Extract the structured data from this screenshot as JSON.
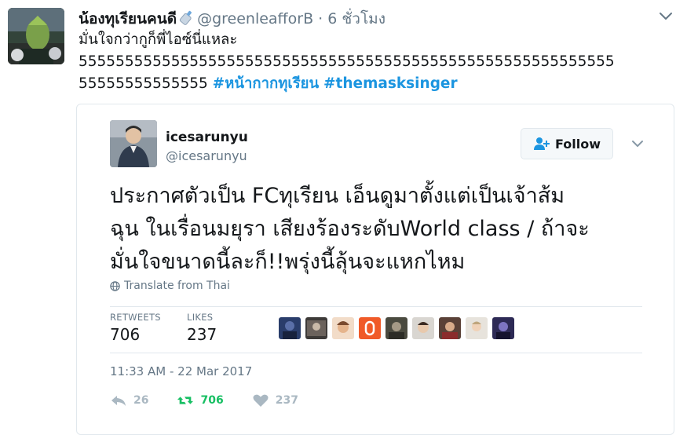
{
  "tweet": {
    "display_name": "น้องทุเรียนคนดี",
    "handle": "@greenleafforB",
    "separator": "·",
    "time": "6 ชั่วโมง",
    "text_line1": "มั่นใจกว่ากูก็พี่ไอซ์นี่แหละ",
    "text_line2": "5555555555555555555555555555555555555555555555555555555555",
    "text_line3_prefix": "55555555555555 ",
    "hashtag1": "#หน้ากากทุเรียน",
    "hashtag2": "#themasksinger"
  },
  "quoted": {
    "display_name": "icesarunyu",
    "handle": "@icesarunyu",
    "follow_label": "Follow",
    "text_lines": [
      "ประกาศตัวเป็น FCทุเรียน เอ็นดูมาตั้งแต่เป็นเจ้าส้ม",
      "ฉุน ในเรื่อนมยุรา เสียงร้องระดับWorld class / ถ้าจะ",
      "มั่นใจขนาดนี้ละก็!!พรุ่งนี้ลุ้นจะแหกไหม"
    ],
    "translate_label": "Translate from Thai",
    "retweets_label": "RETWEETS",
    "retweets_value": "706",
    "likes_label": "LIKES",
    "likes_value": "237",
    "timestamp": "11:33 AM - 22 Mar 2017",
    "actions": {
      "reply_count": "26",
      "retweet_count": "706",
      "like_count": "237"
    }
  },
  "colors": {
    "link": "#1b95e0",
    "muted": "#657786",
    "retweet_green": "#17bf63",
    "border": "#e1e8ed"
  },
  "icons": [
    "bottle-icon",
    "chevron-down-icon",
    "add-user-icon",
    "globe-icon",
    "reply-icon",
    "retweet-icon",
    "heart-icon"
  ]
}
